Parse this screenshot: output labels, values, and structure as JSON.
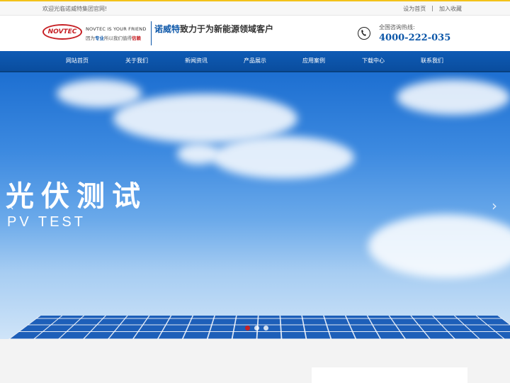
{
  "topbar": {
    "welcome": "欢迎光临诺威特集团官网!",
    "set_home": "设为首页",
    "separator": "|",
    "favorite": "加入收藏"
  },
  "header": {
    "logo_text": "NOVTEC",
    "tagline_en": "NOVTEC IS YOUR FRIEND",
    "tagline_cn_pre": "因为",
    "tagline_cn_hl1": "专业",
    "tagline_cn_mid": "所以我们值得",
    "tagline_cn_hl2": "信赖",
    "slogan_brand": "诺威特",
    "slogan_rest": "致力于为新能源领域客户",
    "hotline_label": "全国咨询热线:",
    "hotline_number": "4000-222-035"
  },
  "nav": {
    "items": [
      {
        "label": "网站首页"
      },
      {
        "label": "关于我们"
      },
      {
        "label": "新闻资讯"
      },
      {
        "label": "产品展示"
      },
      {
        "label": "应用案例"
      },
      {
        "label": "下载中心"
      },
      {
        "label": "联系我们"
      }
    ]
  },
  "banner": {
    "title_cn": "光伏测试",
    "title_en": "PV TEST",
    "prev_arrow": "‹",
    "next_arrow": "›",
    "active_slide": 1,
    "slide_count": 3
  },
  "colors": {
    "brand_blue": "#0b56a8",
    "brand_red": "#c61f24",
    "top_accent": "#f3c21a"
  }
}
